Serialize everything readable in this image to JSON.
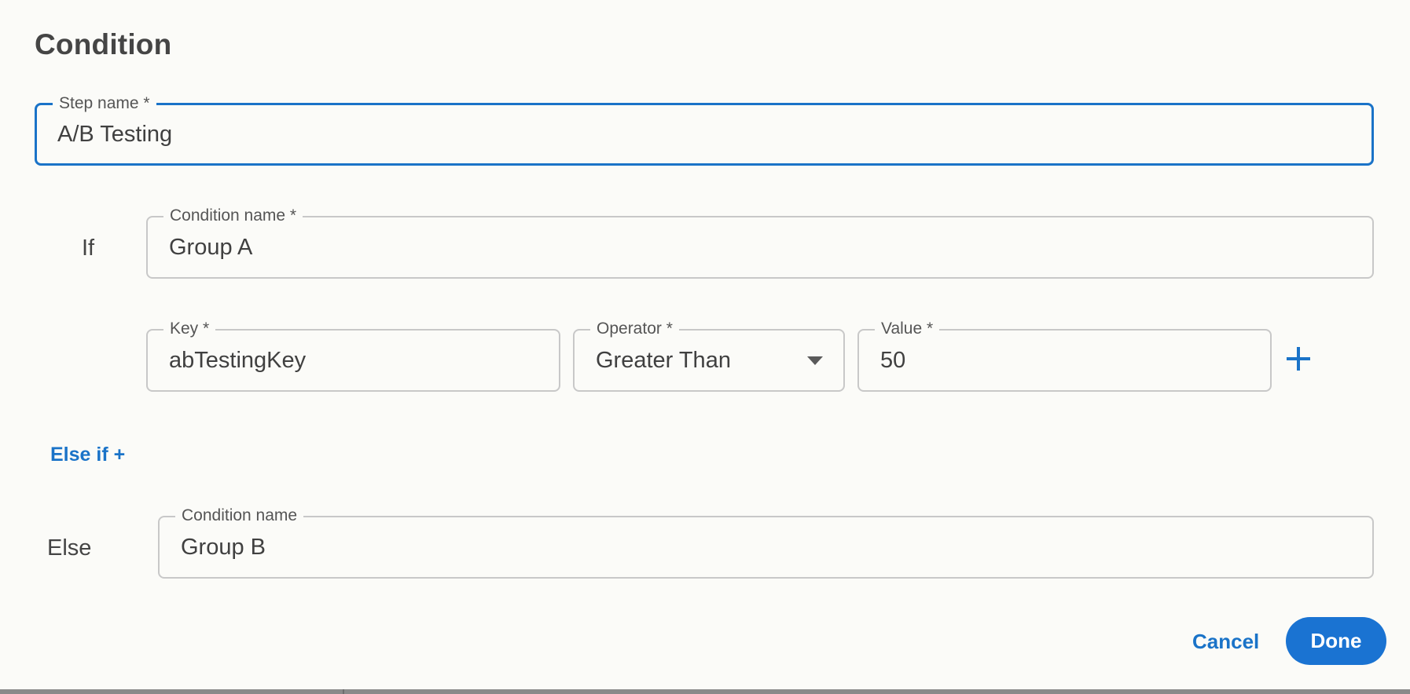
{
  "dialog": {
    "title": "Condition"
  },
  "step_name": {
    "label": "Step name *",
    "value": "A/B Testing"
  },
  "if_block": {
    "side_label": "If",
    "condition_name": {
      "label": "Condition name *",
      "value": "Group A"
    },
    "key": {
      "label": "Key *",
      "value": "abTestingKey"
    },
    "operator": {
      "label": "Operator *",
      "value": "Greater Than"
    },
    "value": {
      "label": "Value *",
      "value": "50"
    },
    "add_rule_icon": "plus-icon"
  },
  "else_if_link": "Else if +",
  "else_block": {
    "side_label": "Else",
    "condition_name": {
      "label": "Condition name",
      "value": "Group B"
    }
  },
  "actions": {
    "cancel_label": "Cancel",
    "done_label": "Done"
  },
  "colors": {
    "accent": "#1a73c8",
    "background": "#fbfbf8",
    "border": "#c8c8c8"
  }
}
